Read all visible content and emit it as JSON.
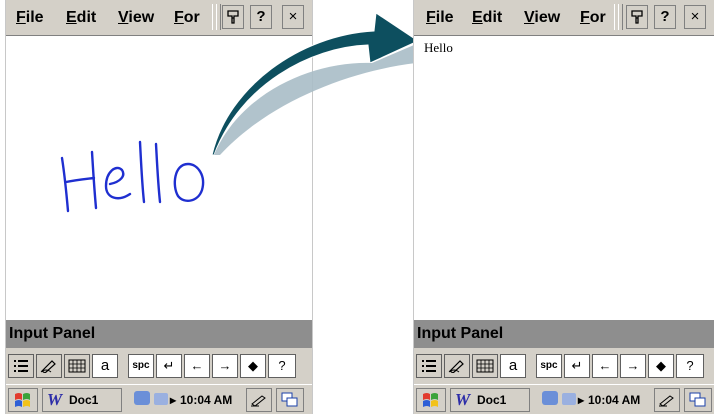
{
  "menu": {
    "file": "File",
    "edit": "Edit",
    "view": "View",
    "format": "For",
    "help_btn": "?",
    "close_btn": "×"
  },
  "input_panel": {
    "title": "Input Panel"
  },
  "sip_keys": {
    "letter_mode": "a",
    "space": "spc",
    "enter": "↵",
    "left": "←",
    "right": "→",
    "backspace": "◆",
    "help": "?"
  },
  "taskbar": {
    "doc_label": "Doc1",
    "time": "10:04 AM"
  },
  "handwriting": "Hello",
  "document_text": "Hello",
  "colors": {
    "ink": "#1f2fd0",
    "arrow_dark": "#0d4f5f",
    "arrow_shadow": "#a9bcc7"
  }
}
